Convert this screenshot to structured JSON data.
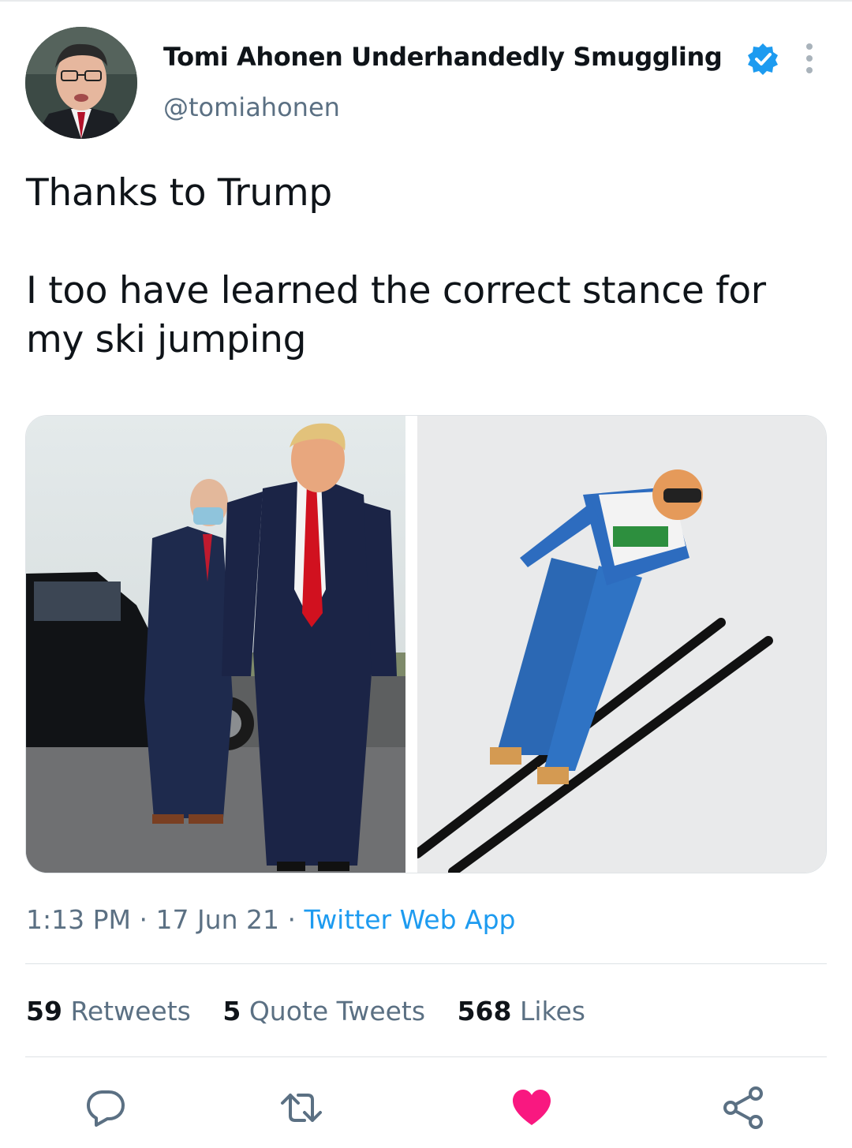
{
  "author": {
    "name": "Tomi Ahonen Underhandedly Smuggling ...",
    "handle": "@tomiahonen",
    "verified": true
  },
  "tweet": {
    "lines": [
      "Thanks to Trump",
      "I too have learned the correct stance for",
      "my ski jumping"
    ]
  },
  "meta": {
    "time": "1:13 PM",
    "date": "17 Jun 21",
    "source": "Twitter Web App",
    "separator": "·"
  },
  "stats": {
    "retweets_count": "59",
    "retweets_label": "Retweets",
    "quote_count": "5",
    "quote_label": "Quote Tweets",
    "likes_count": "568",
    "likes_label": "Likes"
  },
  "actions": [
    "reply-icon",
    "retweet-icon",
    "like-icon",
    "share-icon"
  ],
  "colors": {
    "accent": "#1d9bf0",
    "like": "#f91880",
    "muted": "#5b7083",
    "text": "#0f1419"
  }
}
